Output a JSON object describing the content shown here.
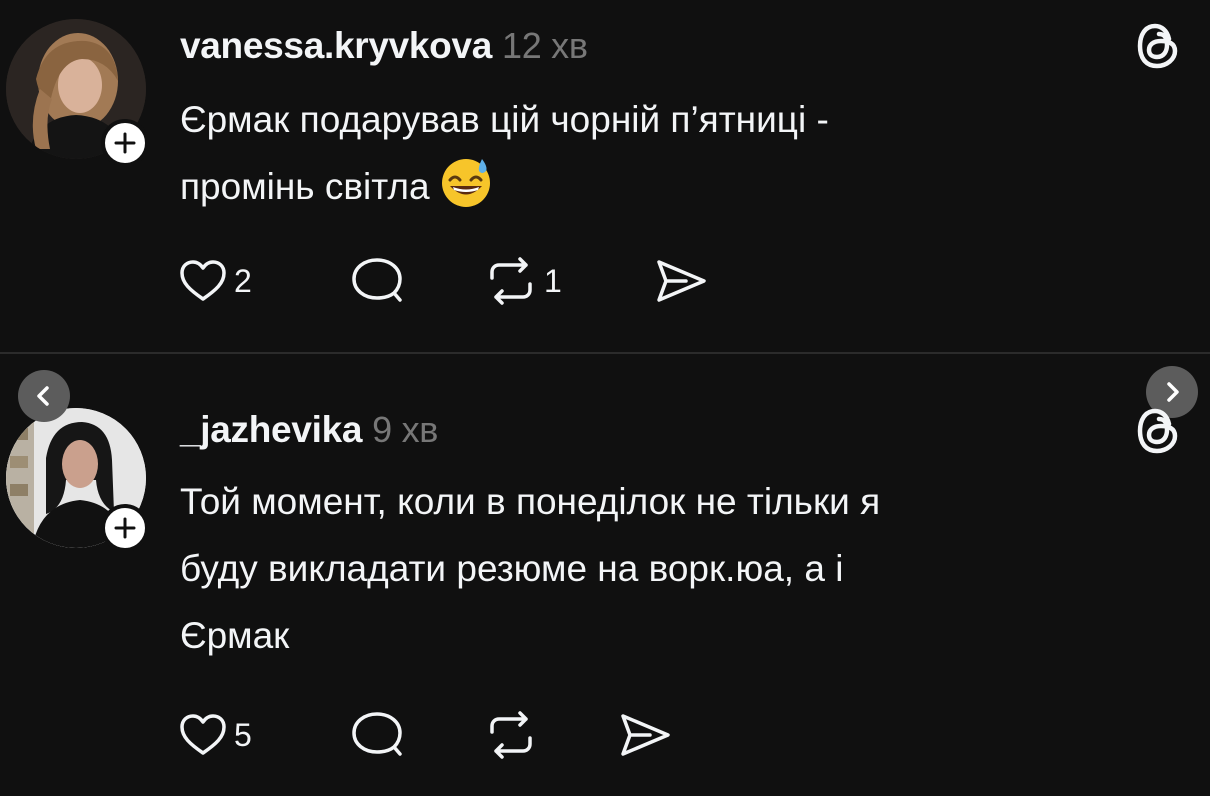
{
  "posts": [
    {
      "username": "vanessa.kryvkova",
      "time": "12 хв",
      "text_line1": "Єрмак подарував цій чорній п’ятниці -",
      "text_line2": "промінь світла",
      "emoji": "grinning-face-with-sweat",
      "likes": "2",
      "reposts": "1"
    },
    {
      "username": "_jazhevika",
      "time": "9 хв",
      "text": "Той момент, коли в понеділок не тільки я\nбуду викладати резюме на ворк.юа, а і\nЄрмак",
      "likes": "5"
    }
  ],
  "icons": {
    "follow": "plus-icon",
    "logo": "threads-logo-icon",
    "like": "heart-icon",
    "comment": "comment-bubble-icon",
    "repost": "repost-icon",
    "share": "send-icon",
    "prev": "chevron-left-icon",
    "next": "chevron-right-icon"
  },
  "colors": {
    "background": "#101010",
    "text": "#f3f5f7",
    "muted": "#777777",
    "divider": "#2b2b2b"
  }
}
